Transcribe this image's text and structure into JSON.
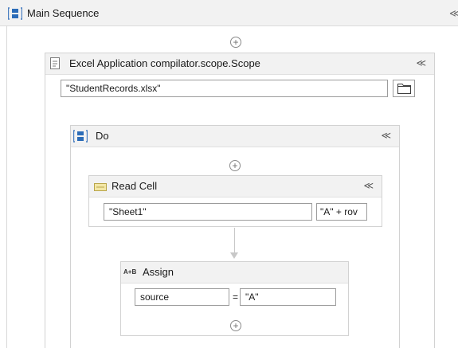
{
  "main_sequence": {
    "title": "Main Sequence",
    "collapse_glyph": "≪",
    "icon": "sequence-icon"
  },
  "scope": {
    "title": "Excel Application compilator.scope.Scope",
    "collapse_glyph": "≪",
    "icon": "excel-scope-icon",
    "workbook_path": "\"StudentRecords.xlsx\"",
    "folder_icon": "folder-icon"
  },
  "do_sequence": {
    "title": "Do",
    "collapse_glyph": "≪",
    "icon": "sequence-icon"
  },
  "read_cell": {
    "title": "Read Cell",
    "collapse_glyph": "≪",
    "icon": "read-cell-icon",
    "sheet_name": "\"Sheet1\"",
    "cell_expr": "\"A\" + rov"
  },
  "assign": {
    "title": "Assign",
    "icon_text": "A+B",
    "to": "source",
    "equals": "=",
    "value": "\"A\""
  },
  "add_glyph": "+"
}
